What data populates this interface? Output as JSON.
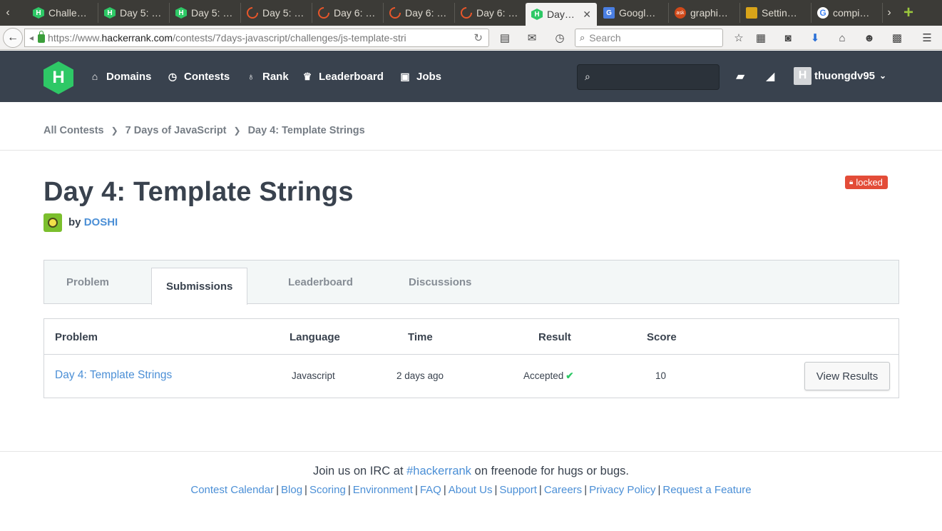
{
  "browser": {
    "tabs": [
      {
        "title": "Challe…",
        "favicon": "hackerrank-icon"
      },
      {
        "title": "Day 5: …",
        "favicon": "hackerrank-icon"
      },
      {
        "title": "Day 5: …",
        "favicon": "hackerrank-icon"
      },
      {
        "title": "Day 5: …",
        "favicon": "loading-icon"
      },
      {
        "title": "Day 6: …",
        "favicon": "loading-icon"
      },
      {
        "title": "Day 6: …",
        "favicon": "loading-icon"
      },
      {
        "title": "Day 6: …",
        "favicon": "loading-icon"
      },
      {
        "title": "Day…",
        "favicon": "hackerrank-icon",
        "active": true
      },
      {
        "title": "Googl…",
        "favicon": "google-translate-icon"
      },
      {
        "title": "graphi…",
        "favicon": "ask-icon"
      },
      {
        "title": "Settin…",
        "favicon": "settings-icon"
      },
      {
        "title": "compi…",
        "favicon": "google-icon"
      }
    ],
    "url": {
      "prefix": "https://www.",
      "host": "hackerrank.com",
      "path": "/contests/7days-javascript/challenges/js-template-stri"
    },
    "search_placeholder": "Search"
  },
  "header": {
    "logo": "H",
    "nav": [
      {
        "label": "Domains",
        "icon": "home-icon"
      },
      {
        "label": "Contests",
        "icon": "clock-icon"
      },
      {
        "label": "Rank",
        "icon": "medal-icon"
      },
      {
        "label": "Leaderboard",
        "icon": "trophy-icon"
      },
      {
        "label": "Jobs",
        "icon": "briefcase-icon"
      }
    ],
    "username": "thuongdv95"
  },
  "breadcrumb": [
    "All Contests",
    "7 Days of JavaScript",
    "Day 4: Template Strings"
  ],
  "page": {
    "title": "Day 4: Template Strings",
    "badge": "locked",
    "by": "by",
    "author": "DOSHI"
  },
  "tabs": [
    "Problem",
    "Submissions",
    "Leaderboard",
    "Discussions"
  ],
  "table": {
    "headers": [
      "Problem",
      "Language",
      "Time",
      "Result",
      "Score"
    ],
    "row": {
      "problem": "Day 4: Template Strings",
      "language": "Javascript",
      "time": "2 days ago",
      "result": "Accepted",
      "score": "10",
      "action": "View Results"
    }
  },
  "footer": {
    "irc_pre": "Join us on IRC at",
    "irc_channel": "#hackerrank",
    "irc_post": "on freenode for hugs or bugs.",
    "links": [
      "Contest Calendar",
      "Blog",
      "Scoring",
      "Environment",
      "FAQ",
      "About Us",
      "Support",
      "Careers",
      "Privacy Policy",
      "Request a Feature"
    ]
  },
  "colors": {
    "header_bg": "#39424e",
    "brand_green": "#2ec866",
    "link_blue": "#4b8fd6",
    "locked_red": "#e34c38"
  }
}
